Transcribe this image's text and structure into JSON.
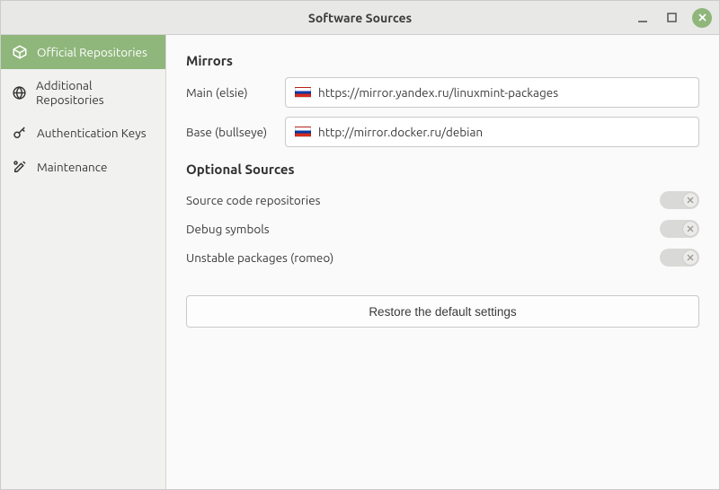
{
  "window": {
    "title": "Software Sources"
  },
  "sidebar": {
    "items": [
      {
        "label": "Official Repositories",
        "icon": "box"
      },
      {
        "label": "Additional Repositories",
        "icon": "globe"
      },
      {
        "label": "Authentication Keys",
        "icon": "key"
      },
      {
        "label": "Maintenance",
        "icon": "tools"
      }
    ]
  },
  "mirrors": {
    "title": "Mirrors",
    "rows": [
      {
        "label": "Main (elsie)",
        "flag": "ru",
        "url": "https://mirror.yandex.ru/linuxmint-packages"
      },
      {
        "label": "Base (bullseye)",
        "flag": "ru",
        "url": "http://mirror.docker.ru/debian"
      }
    ]
  },
  "optional": {
    "title": "Optional Sources",
    "rows": [
      {
        "label": "Source code repositories",
        "on": false
      },
      {
        "label": "Debug symbols",
        "on": false
      },
      {
        "label": "Unstable packages (romeo)",
        "on": false
      }
    ]
  },
  "restore": {
    "label": "Restore the default settings"
  }
}
